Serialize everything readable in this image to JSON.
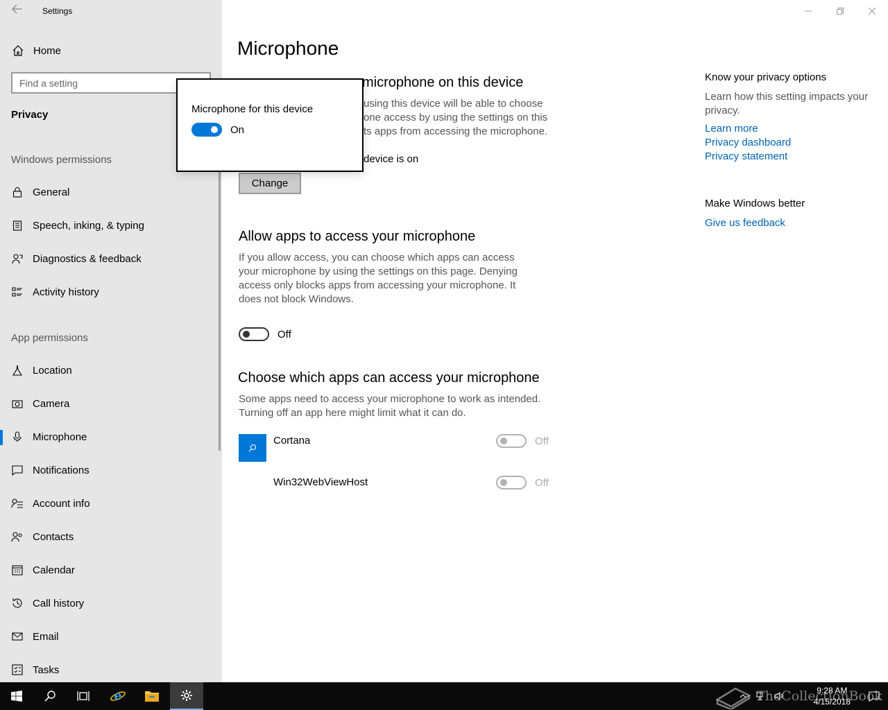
{
  "window": {
    "title": "Settings",
    "back_icon": "back-arrow-icon"
  },
  "sidebar": {
    "home_label": "Home",
    "search_placeholder": "Find a setting",
    "section": "Privacy",
    "windows_permissions_label": "Windows permissions",
    "windows_permissions": [
      {
        "label": "General",
        "icon": "lock-icon"
      },
      {
        "label": "Speech, inking, & typing",
        "icon": "clipboard-icon"
      },
      {
        "label": "Diagnostics & feedback",
        "icon": "person-feedback-icon"
      },
      {
        "label": "Activity history",
        "icon": "activity-icon"
      }
    ],
    "app_permissions_label": "App permissions",
    "app_permissions": [
      {
        "label": "Location",
        "icon": "location-icon"
      },
      {
        "label": "Camera",
        "icon": "camera-icon"
      },
      {
        "label": "Microphone",
        "icon": "microphone-icon",
        "active": true
      },
      {
        "label": "Notifications",
        "icon": "notification-icon"
      },
      {
        "label": "Account info",
        "icon": "account-info-icon"
      },
      {
        "label": "Contacts",
        "icon": "contacts-icon"
      },
      {
        "label": "Calendar",
        "icon": "calendar-icon"
      },
      {
        "label": "Call history",
        "icon": "call-history-icon"
      },
      {
        "label": "Email",
        "icon": "email-icon"
      },
      {
        "label": "Tasks",
        "icon": "tasks-icon"
      }
    ]
  },
  "main": {
    "page_title": "Microphone",
    "device_section": {
      "heading_visible": "microphone on this device",
      "desc_lines": [
        "using this device will be able to choose",
        "one access by using the settings on this",
        "ts apps from accessing the microphone."
      ],
      "status_visible": "device is on",
      "change_label": "Change"
    },
    "allow_section": {
      "heading": "Allow apps to access your microphone",
      "description": "If you allow access, you can choose which apps can access your microphone by using the settings on this page. Denying access only blocks apps from accessing your microphone. It does not block Windows.",
      "toggle_label": "Off"
    },
    "choose_section": {
      "heading": "Choose which apps can access your microphone",
      "description": "Some apps need to access your microphone to work as intended. Turning off an app here might limit what it can do.",
      "apps": [
        {
          "name": "Cortana",
          "state": "Off",
          "icon": "search-icon"
        },
        {
          "name": "Win32WebViewHost",
          "state": "Off"
        }
      ]
    }
  },
  "aside": {
    "privacy_heading": "Know your privacy options",
    "privacy_desc": "Learn how this setting impacts your privacy.",
    "links": [
      "Learn more",
      "Privacy dashboard",
      "Privacy statement"
    ],
    "better_heading": "Make Windows better",
    "feedback_link": "Give us feedback"
  },
  "popup": {
    "title": "Microphone for this device",
    "toggle_label": "On"
  },
  "taskbar": {
    "time": "9:28 AM",
    "date": "4/15/2018",
    "watermark": "TheCollectionBook",
    "accent": "#0078d7"
  }
}
